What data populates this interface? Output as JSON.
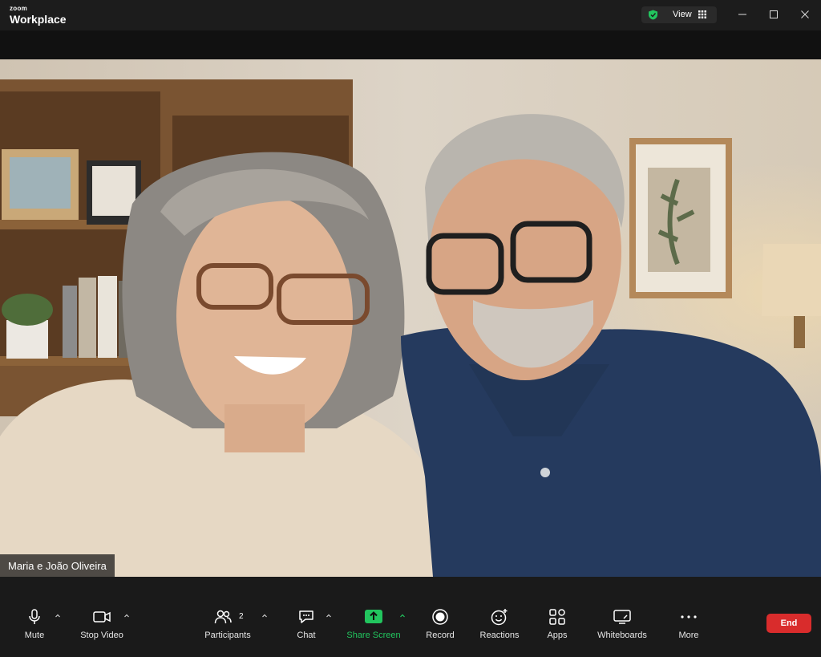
{
  "titlebar": {
    "brand_small": "zoom",
    "brand_big": "Workplace",
    "view_label": "View"
  },
  "video": {
    "participant_name": "Maria e João Oliveira"
  },
  "toolbar": {
    "mute": "Mute",
    "stop_video": "Stop Video",
    "participants": "Participants",
    "participants_count": "2",
    "chat": "Chat",
    "share_screen": "Share Screen",
    "record": "Record",
    "reactions": "Reactions",
    "apps": "Apps",
    "whiteboards": "Whiteboards",
    "more": "More",
    "end": "End"
  },
  "colors": {
    "accent_green": "#22c55e",
    "end_red": "#d92c2c",
    "toolbar_bg": "#1a1a1a"
  }
}
